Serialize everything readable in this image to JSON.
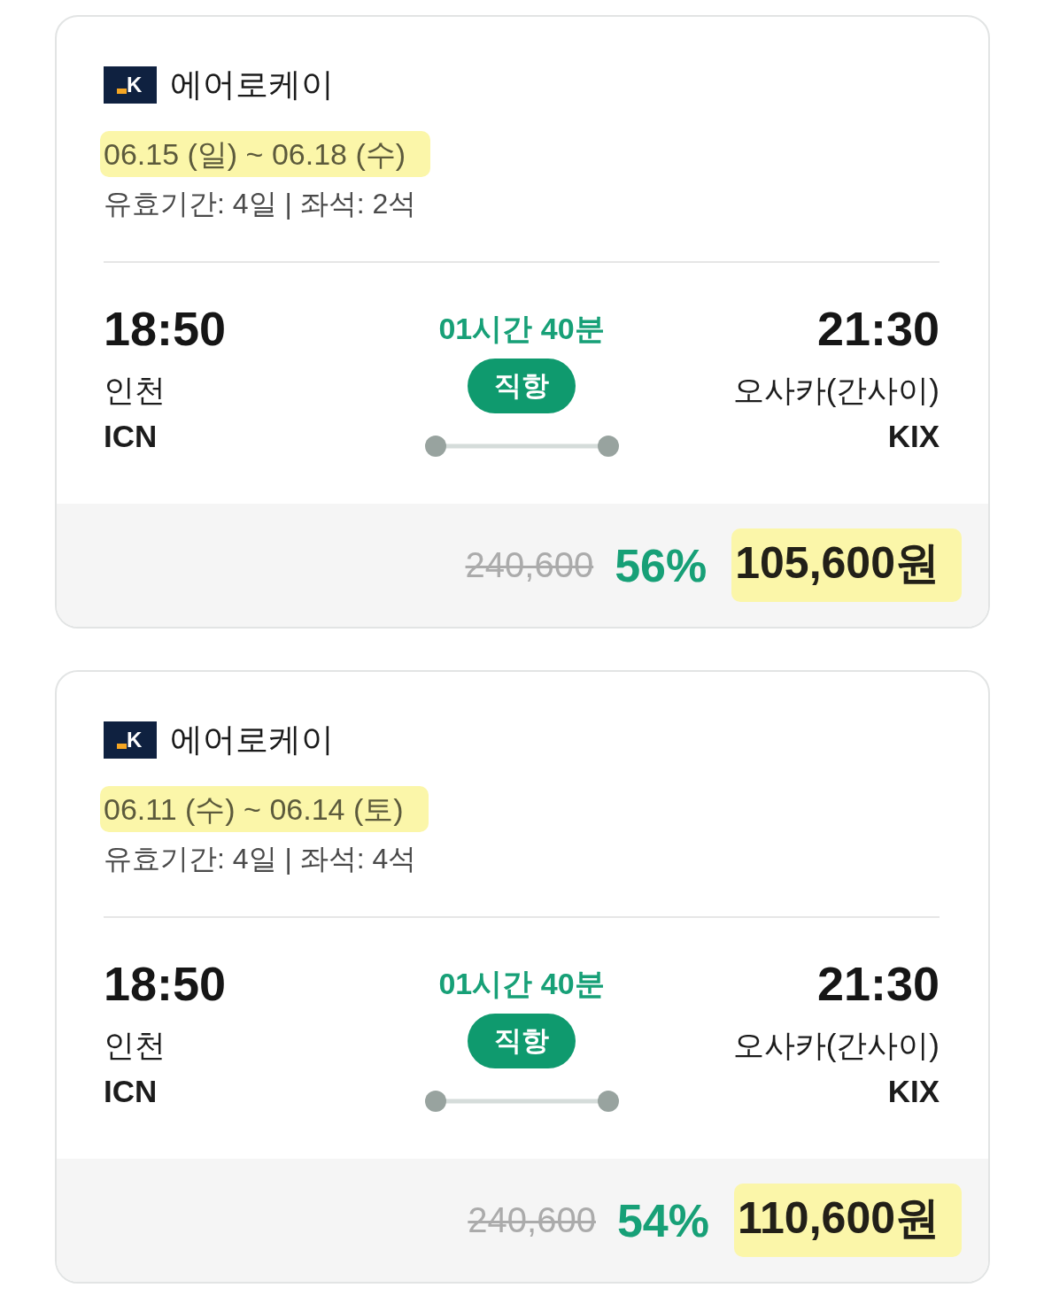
{
  "flights": [
    {
      "airline": {
        "logo_text": "K",
        "name": "에어로케이"
      },
      "dates": {
        "text": "06.15 (일) ~ 06.18 (수)",
        "highlighted": true
      },
      "details": "유효기간: 4일 | 좌석: 2석",
      "departure": {
        "time": "18:50",
        "city": "인천",
        "code": "ICN"
      },
      "duration": "01시간 40분",
      "stop_badge": "직항",
      "arrival": {
        "time": "21:30",
        "city": "오사카(간사이)",
        "code": "KIX"
      },
      "price": {
        "original": "240,600",
        "discount": "56%",
        "final": "105,600원",
        "highlighted": true
      }
    },
    {
      "airline": {
        "logo_text": "K",
        "name": "에어로케이"
      },
      "dates": {
        "text": "06.11 (수) ~ 06.14 (토)",
        "highlighted": true
      },
      "details": "유효기간: 4일 | 좌석: 4석",
      "departure": {
        "time": "18:50",
        "city": "인천",
        "code": "ICN"
      },
      "duration": "01시간 40분",
      "stop_badge": "직항",
      "arrival": {
        "time": "21:30",
        "city": "오사카(간사이)",
        "code": "KIX"
      },
      "price": {
        "original": "240,600",
        "discount": "54%",
        "final": "110,600원",
        "highlighted": true
      }
    }
  ]
}
